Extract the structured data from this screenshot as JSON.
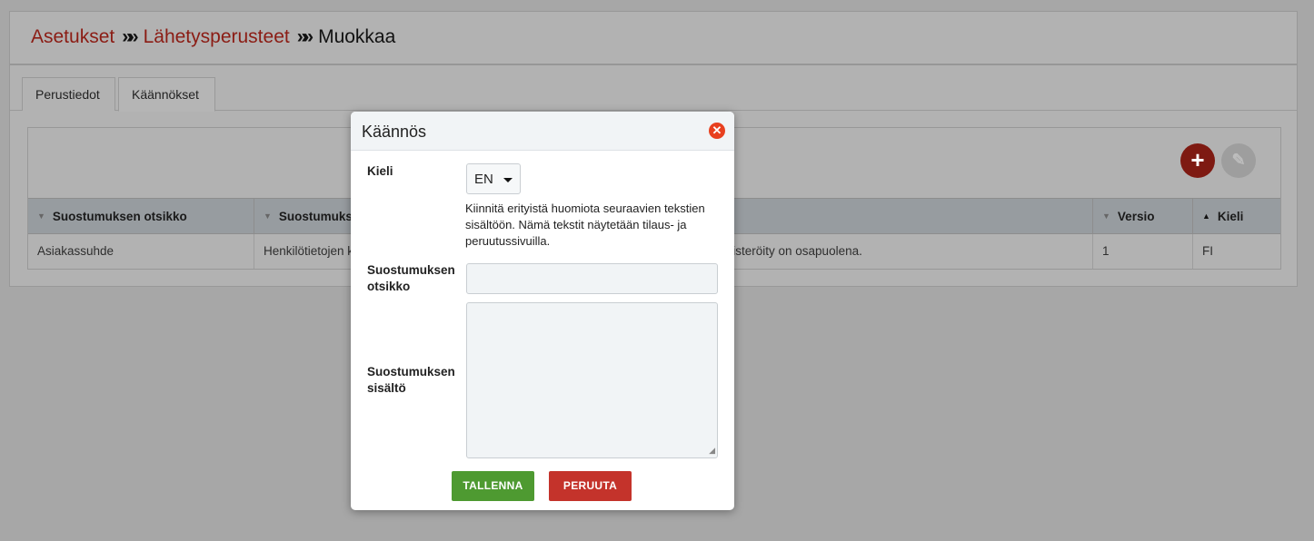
{
  "breadcrumb": {
    "items": [
      "Asetukset",
      "Lähetysperusteet"
    ],
    "separator": "»",
    "current": "Muokkaa"
  },
  "tabs": [
    {
      "label": "Perustiedot",
      "active": false
    },
    {
      "label": "Käännökset",
      "active": true
    }
  ],
  "toolbar": {
    "add_icon": "+",
    "edit_icon": "✎"
  },
  "table": {
    "columns": [
      {
        "label": "Suostumuksen otsikko",
        "sort": "desc"
      },
      {
        "label": "Suostumuks",
        "sort": "desc"
      },
      {
        "label": "Versio",
        "sort": "desc"
      },
      {
        "label": "Kieli",
        "sort": "asc"
      }
    ],
    "rows": [
      {
        "title": "Asiakassuhde",
        "content_left": "Henkilötietojen k",
        "content_right": "ekisteröity on osapuolena.",
        "version": "1",
        "language": "FI"
      }
    ]
  },
  "modal": {
    "title": "Käännös",
    "close_icon": "✕",
    "language_label": "Kieli",
    "language_value": "EN",
    "note": "Kiinnitä erityistä huomiota seuraavien tekstien sisältöön. Nämä tekstit näytetään tilaus- ja peruutussivuilla.",
    "title_label_1": "Suostumuksen",
    "title_label_2": "otsikko",
    "title_value": "",
    "content_label_1": "Suostumuksen",
    "content_label_2": "sisältö",
    "content_value": "",
    "save_label": "TALLENNA",
    "cancel_label": "PERUUTA"
  },
  "colors": {
    "brand_red": "#c4332b",
    "save_green": "#4e9a31",
    "close_orange": "#e8401f"
  }
}
